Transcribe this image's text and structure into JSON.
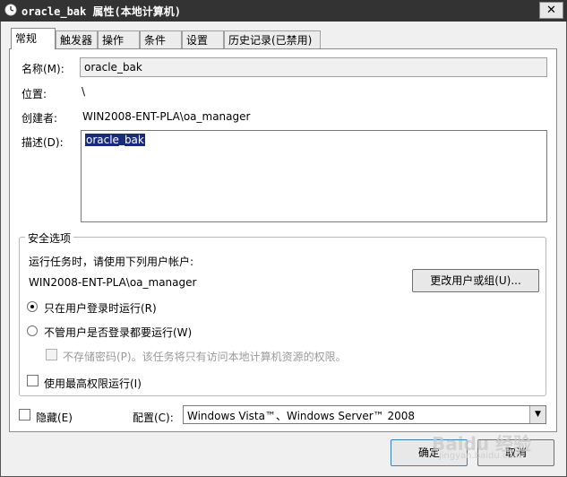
{
  "window": {
    "title": "oracle_bak 属性(本地计算机)",
    "close_glyph": "✕"
  },
  "tabs": [
    {
      "label": "常规",
      "active": true
    },
    {
      "label": "触发器"
    },
    {
      "label": "操作"
    },
    {
      "label": "条件"
    },
    {
      "label": "设置"
    },
    {
      "label": "历史记录(已禁用)"
    }
  ],
  "general": {
    "name_label": "名称(M):",
    "name_value": "oracle_bak",
    "location_label": "位置:",
    "location_value": "\\",
    "author_label": "创建者:",
    "author_value": "WIN2008-ENT-PLA\\oa_manager",
    "description_label": "描述(D):",
    "description_value": "oracle_bak"
  },
  "security": {
    "group_title": "安全选项",
    "run_as_text": "运行任务时，请使用下列用户帐户:",
    "user_account": "WIN2008-ENT-PLA\\oa_manager",
    "change_user_button": "更改用户或组(U)...",
    "radio_logged_on": "只在用户登录时运行(R)",
    "radio_whether_logged": "不管用户是否登录都要运行(W)",
    "no_store_password": "不存储密码(P)。该任务将只有访问本地计算机资源的权限。",
    "highest_privileges": "使用最高权限运行(I)",
    "selected_radio": "radio_logged_on"
  },
  "bottom": {
    "hidden_label": "隐藏(E)",
    "configure_label": "配置(C):",
    "configure_value": "Windows Vista™、Windows Server™ 2008"
  },
  "buttons": {
    "ok": "确定",
    "cancel": "取消"
  },
  "watermark": {
    "main": "Baidu 经验",
    "sub": "jingyan.baidu.com"
  },
  "colors": {
    "titlebar": "#333333",
    "selection": "#1b2b7c"
  }
}
